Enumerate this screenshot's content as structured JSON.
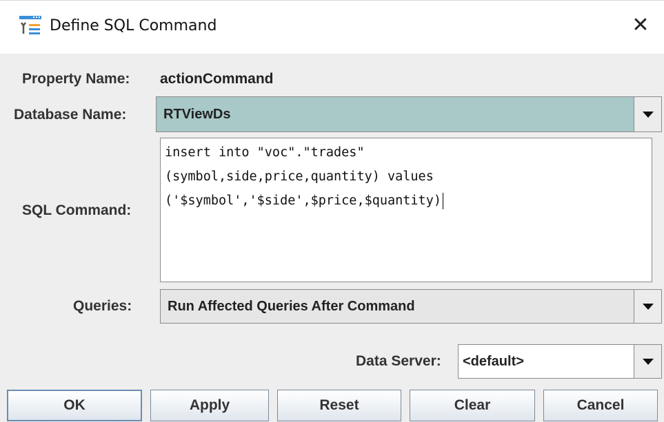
{
  "window": {
    "title": "Define SQL Command"
  },
  "form": {
    "property_name": {
      "label": "Property Name:",
      "value": "actionCommand"
    },
    "database_name": {
      "label": "Database Name:",
      "value": "RTViewDs",
      "highlight_color": "#a9c8c8"
    },
    "sql_command": {
      "label": "SQL Command:",
      "lines": [
        "insert into \"voc\".\"trades\"",
        "(symbol,side,price,quantity) values",
        "('$symbol','$side',$price,$quantity)"
      ]
    },
    "queries": {
      "label": "Queries:",
      "value": "Run Affected Queries After Command"
    },
    "data_server": {
      "label": "Data Server:",
      "value": "<default>"
    }
  },
  "buttons": {
    "ok": "OK",
    "apply": "Apply",
    "reset": "Reset",
    "clear": "Clear",
    "cancel": "Cancel"
  },
  "icons": {
    "app": "tools-icon",
    "close": "close-icon",
    "dropdown": "chevron-down-icon"
  }
}
